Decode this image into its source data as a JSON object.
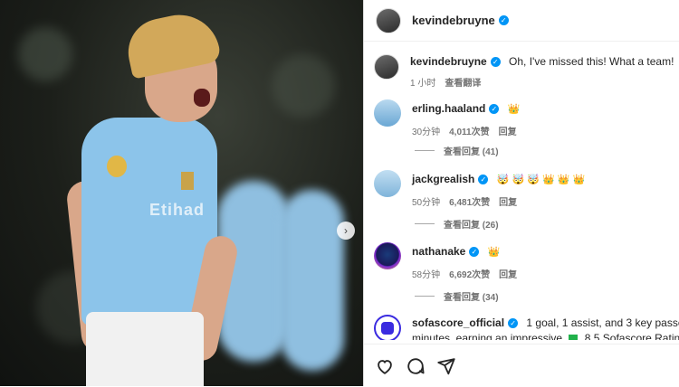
{
  "post": {
    "author": "kevindebruyne",
    "caption": "Oh, I've missed this! What a team!",
    "caption_emoji": "💙",
    "caption_time": "1 小时",
    "translate_label": "查看翻译",
    "photo_sponsor_text": "Etihad"
  },
  "comments": [
    {
      "user": "erling.haaland",
      "text": "",
      "emojis": "👑",
      "time": "30分钟",
      "likes": "4,011次赞",
      "reply": "回复",
      "view_replies": "查看回复 (41)"
    },
    {
      "user": "jackgrealish",
      "text": "",
      "emojis": "🤯 🤯 🤯 👑 👑 👑",
      "time": "50分钟",
      "likes": "6,481次赞",
      "reply": "回复",
      "view_replies": "查看回复 (26)"
    },
    {
      "user": "nathanake",
      "text": "",
      "emojis": "👑",
      "time": "58分钟",
      "likes": "6,692次赞",
      "reply": "回复",
      "view_replies": "查看回复 (34)"
    },
    {
      "user": "sofascore_official",
      "text": "1 goal, 1 assist, and 3 key passes in just",
      "text_line2": "minutes, earning an impressive",
      "rating_text": "8.5 Sofascore Rating! Ale"
    }
  ],
  "icons": {
    "next": "chevron-right-icon",
    "like": "heart-icon",
    "comment": "comment-icon",
    "share": "share-icon",
    "verified": "verified-badge-icon"
  },
  "colors": {
    "verified": "#0095f6",
    "rating_badge": "#21b14b"
  }
}
